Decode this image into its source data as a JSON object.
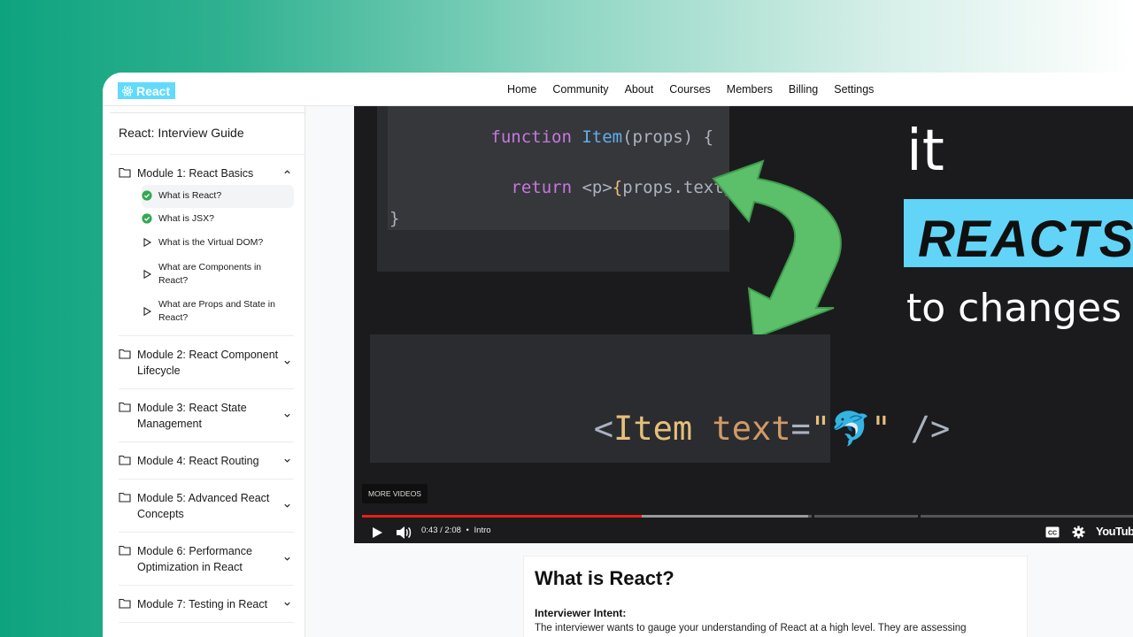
{
  "brand": {
    "logo_label": "React",
    "accent": "#61dafb"
  },
  "nav": {
    "items": [
      "Home",
      "Community",
      "About",
      "Courses",
      "Members",
      "Billing",
      "Settings"
    ]
  },
  "sidebar": {
    "title": "React: Interview Guide",
    "modules": [
      {
        "label": "Module 1: React Basics",
        "expanded": true,
        "lessons": [
          {
            "label": "What is React?",
            "status": "completed",
            "icon": "check-circle-icon"
          },
          {
            "label": "What is JSX?",
            "status": "completed",
            "icon": "check-circle-icon"
          },
          {
            "label": "What is the Virtual DOM?",
            "status": "pending",
            "icon": "play-outline-icon"
          },
          {
            "label": "What are Components in React?",
            "status": "pending",
            "icon": "play-outline-icon"
          },
          {
            "label": "What are Props and State in React?",
            "status": "pending",
            "icon": "play-outline-icon"
          }
        ]
      },
      {
        "label": "Module 2: React Component Lifecycle",
        "expanded": false
      },
      {
        "label": "Module 3: React State Management",
        "expanded": false
      },
      {
        "label": "Module 4: React Routing",
        "expanded": false
      },
      {
        "label": "Module 5: Advanced React Concepts",
        "expanded": false
      },
      {
        "label": "Module 6: Performance Optimization in React",
        "expanded": false
      },
      {
        "label": "Module 7: Testing in React",
        "expanded": false
      }
    ]
  },
  "video": {
    "code_top": [
      "function Item(props) {",
      "return <p>{props.text}</p>",
      "}"
    ],
    "code_bottom": "<Item text=\" \" />",
    "overlay_it": "it",
    "overlay_reacts": "REACTS",
    "overlay_changes": "to changes",
    "more_videos": "MORE VIDEOS",
    "time": "0:43 / 2:08",
    "chapter": "Intro",
    "progress_played": 0.363,
    "progress_buffered": 0.579,
    "brand": "YouTube"
  },
  "article": {
    "title": "What is React?",
    "intent_heading": "Interviewer Intent:",
    "intent_text": "The interviewer wants to gauge your understanding of React at a high level. They are assessing"
  }
}
